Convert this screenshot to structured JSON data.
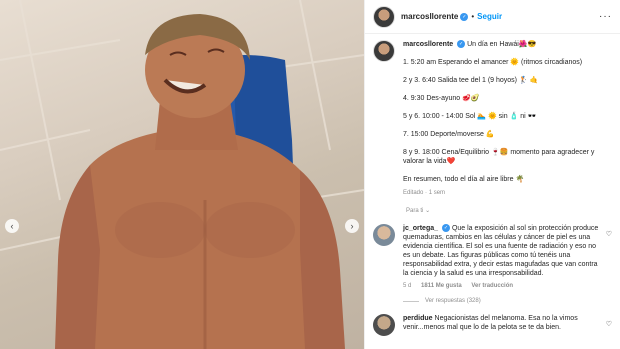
{
  "header": {
    "username": "marcosllorente",
    "follow_label": "Seguir",
    "more_icon": "more-icon"
  },
  "caption": {
    "username": "marcosllorente",
    "lines": [
      "Un día en Hawái🌺😎",
      "1. 5:20 am Esperando el amancer 🌞 (ritmos circadianos)",
      "2 y 3. 6:40 Salida tee del 1 (9 hoyos) 🏌️ 🤙",
      "4. 9:30 Des-ayuno 🥩🥑",
      "5 y 6. 10:00 - 14:00 Sol 🏊 🌞 sin 🧴 ni 🕶️",
      "7. 15:00 Deporte/moverse 💪",
      "8 y 9. 18:00 Cena/Equilibrio 🍷🍔 momento para agradecer y valorar la vida❤️",
      "En resumen, todo el día al aire libre 🌴"
    ],
    "edited": "Editado",
    "time": "1 sem"
  },
  "filter": {
    "label": "Para ti"
  },
  "comments": [
    {
      "username": "jc_ortega_",
      "text": "Que la exposición al sol sin protección produce quemaduras, cambios en las células y cáncer de piel es una evidencia científica. El sol es una fuente de radiación y eso no es un debate. Las figuras públicas como tú tenéis una responsabilidad extra, y decir estas magufadas que van contra la ciencia y la salud es una irresponsabilidad.",
      "time": "5 d",
      "likes": "1811 Me gusta",
      "reply": "Ver traducción",
      "view_replies": "Ver respuestas (328)"
    },
    {
      "username": "perdidue",
      "text": "Negacionistas del melanoma. Esa no la vimos venir...menos mal que lo de la pelota se te da bien."
    }
  ],
  "colors": {
    "accent": "#0095f6",
    "verified": "#3897f0",
    "muted": "#8e8e8e"
  }
}
